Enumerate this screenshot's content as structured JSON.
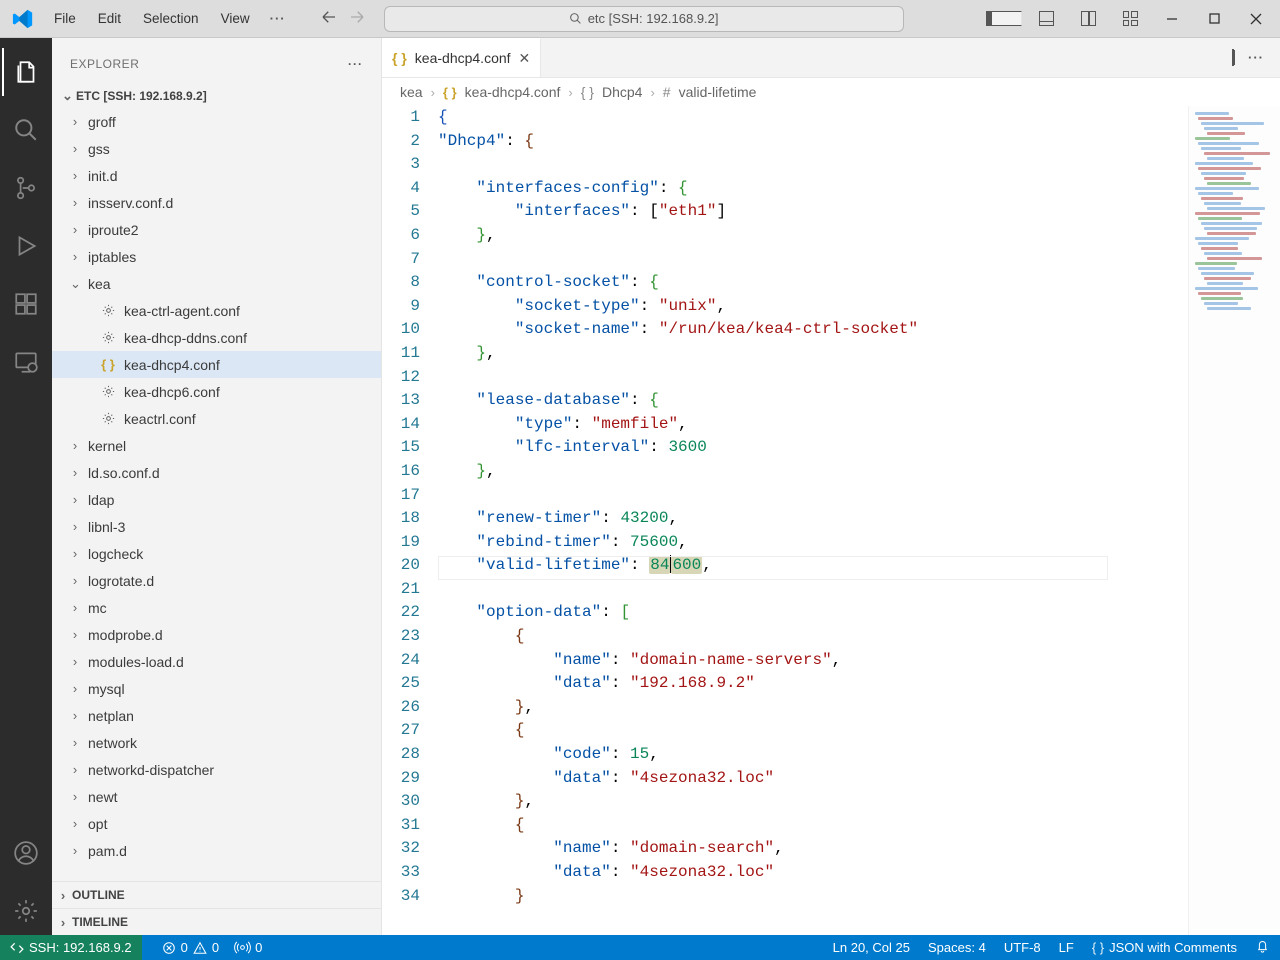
{
  "titlebar": {
    "menus": [
      "File",
      "Edit",
      "Selection",
      "View"
    ],
    "search_label": "etc [SSH: 192.168.9.2]"
  },
  "activity": {
    "items": [
      "explorer",
      "search",
      "scm",
      "debug",
      "extensions",
      "remote"
    ]
  },
  "sidebar": {
    "header": "EXPLORER",
    "root": "ETC [SSH: 192.168.9.2]",
    "folders_top": [
      "groff",
      "gss",
      "init.d",
      "insserv.conf.d",
      "iproute2",
      "iptables"
    ],
    "kea_label": "kea",
    "kea_files": [
      "kea-ctrl-agent.conf",
      "kea-dhcp-ddns.conf",
      "kea-dhcp4.conf",
      "kea-dhcp6.conf",
      "keactrl.conf"
    ],
    "kea_selected": "kea-dhcp4.conf",
    "folders_bottom": [
      "kernel",
      "ld.so.conf.d",
      "ldap",
      "libnl-3",
      "logcheck",
      "logrotate.d",
      "mc",
      "modprobe.d",
      "modules-load.d",
      "mysql",
      "netplan",
      "network",
      "networkd-dispatcher",
      "newt",
      "opt",
      "pam.d"
    ],
    "sections": [
      "OUTLINE",
      "TIMELINE"
    ]
  },
  "tab": {
    "filename": "kea-dhcp4.conf"
  },
  "breadcrumb": {
    "parts": [
      "kea",
      "kea-dhcp4.conf",
      "Dhcp4",
      "valid-lifetime"
    ]
  },
  "code": {
    "lines": [
      {
        "n": 1,
        "html": "<span class='tok-br3'>{</span>"
      },
      {
        "n": 2,
        "html": "<span class='tok-prop'>\"Dhcp4\"</span><span class='tok-punc'>: </span><span class='tok-br2'>{</span>"
      },
      {
        "n": 3,
        "html": ""
      },
      {
        "n": 4,
        "html": "    <span class='tok-prop'>\"interfaces-config\"</span><span class='tok-punc'>: </span><span class='tok-brace'>{</span>"
      },
      {
        "n": 5,
        "html": "        <span class='tok-prop'>\"interfaces\"</span><span class='tok-punc'>: [</span><span class='tok-str'>\"eth1\"</span><span class='tok-punc'>]</span>"
      },
      {
        "n": 6,
        "html": "    <span class='tok-brace'>}</span><span class='tok-punc'>,</span>"
      },
      {
        "n": 7,
        "html": ""
      },
      {
        "n": 8,
        "html": "    <span class='tok-prop'>\"control-socket\"</span><span class='tok-punc'>: </span><span class='tok-brace'>{</span>"
      },
      {
        "n": 9,
        "html": "        <span class='tok-prop'>\"socket-type\"</span><span class='tok-punc'>: </span><span class='tok-str'>\"unix\"</span><span class='tok-punc'>,</span>"
      },
      {
        "n": 10,
        "html": "        <span class='tok-prop'>\"socket-name\"</span><span class='tok-punc'>: </span><span class='tok-str'>\"/run/kea/kea4-ctrl-socket\"</span>"
      },
      {
        "n": 11,
        "html": "    <span class='tok-brace'>}</span><span class='tok-punc'>,</span>"
      },
      {
        "n": 12,
        "html": ""
      },
      {
        "n": 13,
        "html": "    <span class='tok-prop'>\"lease-database\"</span><span class='tok-punc'>: </span><span class='tok-brace'>{</span>"
      },
      {
        "n": 14,
        "html": "        <span class='tok-prop'>\"type\"</span><span class='tok-punc'>: </span><span class='tok-str'>\"memfile\"</span><span class='tok-punc'>,</span>"
      },
      {
        "n": 15,
        "html": "        <span class='tok-prop'>\"lfc-interval\"</span><span class='tok-punc'>: </span><span class='tok-num'>3600</span>"
      },
      {
        "n": 16,
        "html": "    <span class='tok-brace'>}</span><span class='tok-punc'>,</span>"
      },
      {
        "n": 17,
        "html": ""
      },
      {
        "n": 18,
        "html": "    <span class='tok-prop'>\"renew-timer\"</span><span class='tok-punc'>: </span><span class='tok-num'>43200</span><span class='tok-punc'>,</span>"
      },
      {
        "n": 19,
        "html": "    <span class='tok-prop'>\"rebind-timer\"</span><span class='tok-punc'>: </span><span class='tok-num'>75600</span><span class='tok-punc'>,</span>"
      },
      {
        "n": 20,
        "html": "    <span class='tok-prop'>\"valid-lifetime\"</span><span class='tok-punc'>: </span><span class='hl-sel'><span class='tok-num'>84</span></span><span class='cursor'></span><span class='hl-sel'><span class='tok-num'>600</span></span><span class='tok-punc'>,</span>",
        "current": true
      },
      {
        "n": 21,
        "html": ""
      },
      {
        "n": 22,
        "html": "    <span class='tok-prop'>\"option-data\"</span><span class='tok-punc'>: </span><span class='tok-brace'>[</span>"
      },
      {
        "n": 23,
        "html": "        <span class='tok-br2'>{</span>"
      },
      {
        "n": 24,
        "html": "            <span class='tok-prop'>\"name\"</span><span class='tok-punc'>: </span><span class='tok-str'>\"domain-name-servers\"</span><span class='tok-punc'>,</span>"
      },
      {
        "n": 25,
        "html": "            <span class='tok-prop'>\"data\"</span><span class='tok-punc'>: </span><span class='tok-str'>\"192.168.9.2\"</span>"
      },
      {
        "n": 26,
        "html": "        <span class='tok-br2'>}</span><span class='tok-punc'>,</span>"
      },
      {
        "n": 27,
        "html": "        <span class='tok-br2'>{</span>"
      },
      {
        "n": 28,
        "html": "            <span class='tok-prop'>\"code\"</span><span class='tok-punc'>: </span><span class='tok-num'>15</span><span class='tok-punc'>,</span>"
      },
      {
        "n": 29,
        "html": "            <span class='tok-prop'>\"data\"</span><span class='tok-punc'>: </span><span class='tok-str'>\"4sezona32.loc\"</span>"
      },
      {
        "n": 30,
        "html": "        <span class='tok-br2'>}</span><span class='tok-punc'>,</span>"
      },
      {
        "n": 31,
        "html": "        <span class='tok-br2'>{</span>"
      },
      {
        "n": 32,
        "html": "            <span class='tok-prop'>\"name\"</span><span class='tok-punc'>: </span><span class='tok-str'>\"domain-search\"</span><span class='tok-punc'>,</span>"
      },
      {
        "n": 33,
        "html": "            <span class='tok-prop'>\"data\"</span><span class='tok-punc'>: </span><span class='tok-str'>\"4sezona32.loc\"</span>"
      },
      {
        "n": 34,
        "html": "        <span class='tok-br2'>}</span>"
      }
    ]
  },
  "status": {
    "remote": "SSH: 192.168.9.2",
    "errors": "0",
    "warnings": "0",
    "ports": "0",
    "position": "Ln 20, Col 25",
    "indent": "Spaces: 4",
    "encoding": "UTF-8",
    "eol": "LF",
    "language": "JSON with Comments"
  }
}
